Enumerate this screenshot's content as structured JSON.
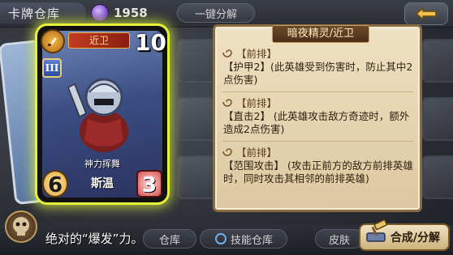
{
  "topbar": {
    "title": "卡牌仓库",
    "coin_value": "1958",
    "decompose_label": "一键分解"
  },
  "card": {
    "class_label": "近卫",
    "cost": "10",
    "tier": "III",
    "skill_name": "神力挥舞",
    "hero_name": "斯温",
    "attack": "6",
    "health": "3"
  },
  "panel": {
    "header": "暗夜精灵/近卫",
    "sections": [
      {
        "title": "【前排】",
        "text": "【护甲2】(此英雄受到伤害时，防止其中2点伤害)"
      },
      {
        "title": "【前排】",
        "text": "【直击2】 (此英雄攻击敌方奇迹时，额外造成2点伤害)"
      },
      {
        "title": "【前排】",
        "text": "【范围攻击】 (攻击正前方的敌方前排英雄时，同时攻击其相邻的前排英雄)"
      }
    ]
  },
  "bottom": {
    "hint": "绝对的“爆发”力。",
    "tab_cards": "仓库",
    "tab_skills": "技能仓库",
    "tab_skins": "皮肤",
    "synth_label": "合成/分解"
  },
  "colors": {
    "card_glow": "#e4f03a",
    "panel_bg": "#efe1c3",
    "panel_border": "#8a6b3e",
    "header_bg": "#6b4a2a"
  }
}
